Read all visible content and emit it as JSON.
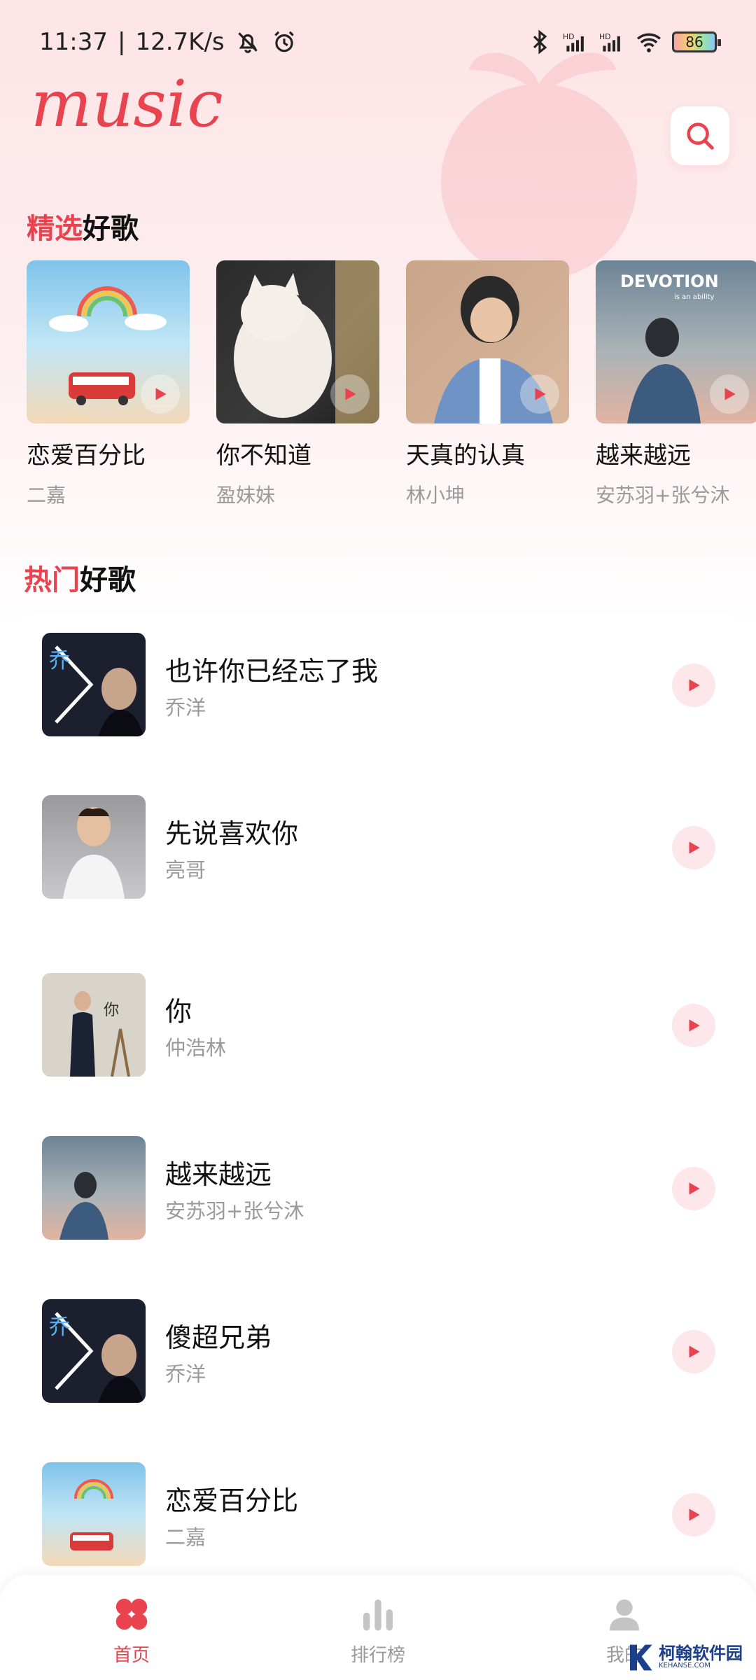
{
  "status_bar": {
    "time": "11:37",
    "separator": "|",
    "speed": "12.7K/s",
    "battery": "86"
  },
  "header": {
    "logo_text": "music"
  },
  "featured": {
    "title_accent": "精选",
    "title_rest": "好歌",
    "items": [
      {
        "title": "恋爱百分比",
        "artist": "二嘉",
        "cover": "love-percent-cover"
      },
      {
        "title": "你不知道",
        "artist": "盈妹妹",
        "cover": "cat-cover"
      },
      {
        "title": "天真的认真",
        "artist": "林小坤",
        "cover": "denim-boy-cover"
      },
      {
        "title": "越来越远",
        "artist": "安苏羽+张兮沐",
        "cover": "devotion-cover",
        "cover_text": "DEVOTION",
        "cover_subtext": "is an ability"
      }
    ]
  },
  "hot": {
    "title_accent": "热门",
    "title_rest": "好歌",
    "songs": [
      {
        "title": "也许你已经忘了我",
        "artist": "乔洋"
      },
      {
        "title": "先说喜欢你",
        "artist": "亮哥"
      },
      {
        "title": "你",
        "artist": "仲浩林"
      },
      {
        "title": "越来越远",
        "artist": "安苏羽+张兮沐"
      },
      {
        "title": "傻超兄弟",
        "artist": "乔洋"
      },
      {
        "title": "恋爱百分比",
        "artist": "二嘉"
      }
    ]
  },
  "nav": {
    "items": [
      {
        "label": "首页",
        "icon": "home-grid-icon",
        "active": true
      },
      {
        "label": "排行榜",
        "icon": "chart-bars-icon",
        "active": false
      },
      {
        "label": "我的",
        "icon": "user-icon",
        "active": false
      }
    ]
  },
  "watermark": {
    "text": "柯翰软件园",
    "sub": "KEHANSE.COM"
  },
  "colors": {
    "accent": "#e8434e",
    "play_bg": "#fde7ea",
    "muted": "#9a9a9a"
  }
}
